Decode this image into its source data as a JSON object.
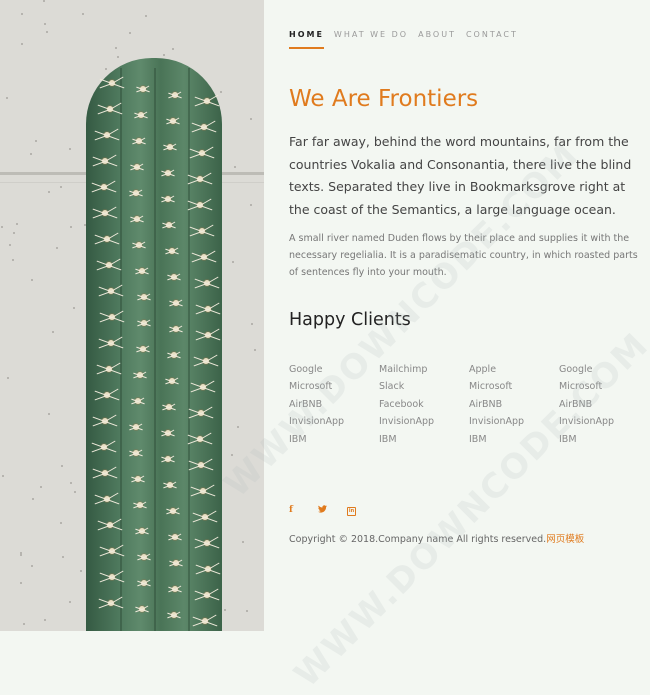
{
  "nav": {
    "items": [
      {
        "label": "HOME",
        "active": true
      },
      {
        "label": "WHAT WE DO",
        "active": false
      },
      {
        "label": "ABOUT",
        "active": false
      },
      {
        "label": "CONTACT",
        "active": false
      }
    ]
  },
  "hero": {
    "title": "We Are Frontiers",
    "lead": "Far far away, behind the word mountains, far from the countries Vokalia and Consonantia, there live the blind texts. Separated they live in Bookmarksgrove right at the coast of the Semantics, a large language ocean.",
    "body": "A small river named Duden flows by their place and supplies it with the necessary regelialia. It is a paradisematic country, in which roasted parts of sentences fly into your mouth."
  },
  "clients": {
    "heading": "Happy Clients",
    "columns": [
      [
        "Google",
        "Microsoft",
        "AirBNB",
        "InvisionApp",
        "IBM"
      ],
      [
        "Mailchimp",
        "Slack",
        "Facebook",
        "InvisionApp",
        "IBM"
      ],
      [
        "Apple",
        "Microsoft",
        "AirBNB",
        "InvisionApp",
        "IBM"
      ],
      [
        "Google",
        "Microsoft",
        "AirBNB",
        "InvisionApp",
        "IBM"
      ]
    ]
  },
  "social": {
    "facebook": "f",
    "twitter": "🐦",
    "linkedin": "in",
    "icons": [
      "facebook-icon",
      "twitter-icon",
      "linkedin-icon"
    ]
  },
  "footer": {
    "copyright": "Copyright © 2018.Company name All rights reserved.",
    "link": "网页模板"
  },
  "watermark": "WWW.DOWNCODE.COM",
  "colors": {
    "accent": "#e07b1e",
    "background": "#f3f7f2"
  }
}
